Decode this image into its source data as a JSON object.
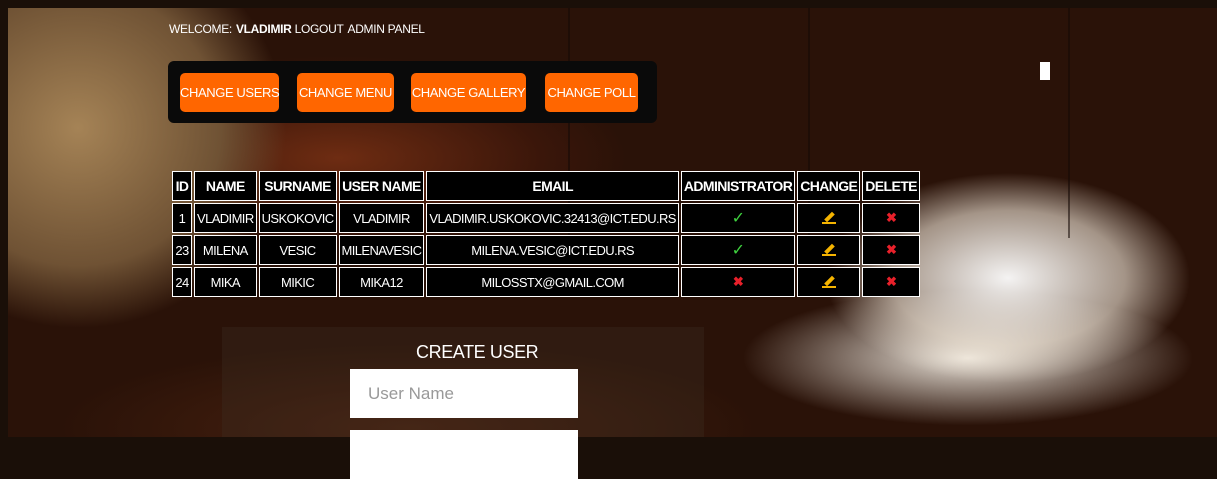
{
  "header": {
    "welcome_prefix": "WELCOME:",
    "username": "VLADIMIR",
    "logout": "LOGOUT",
    "admin_panel": "ADMIN PANEL"
  },
  "nav": {
    "buttons": [
      {
        "label": "CHANGE USERS"
      },
      {
        "label": "CHANGE MENU"
      },
      {
        "label": "CHANGE GALLERY"
      },
      {
        "label": "CHANGE POLL"
      }
    ],
    "button_color": "#ff6600"
  },
  "users_table": {
    "columns": [
      "ID",
      "NAME",
      "SURNAME",
      "USER NAME",
      "EMAIL",
      "ADMINISTRATOR",
      "CHANGE",
      "DELETE"
    ],
    "rows": [
      {
        "id": "1",
        "name": "VLADIMIR",
        "surname": "USKOKOVIC",
        "username": "VLADIMIR",
        "email": "VLADIMIR.USKOKOVIC.32413@ICT.EDU.RS",
        "admin_icon": "check-icon"
      },
      {
        "id": "23",
        "name": "MILENA",
        "surname": "VESIC",
        "username": "MILENAVESIC",
        "email": "MILENA.VESIC@ICT.EDU.RS",
        "admin_icon": "check-icon"
      },
      {
        "id": "24",
        "name": "MIKA",
        "surname": "MIKIC",
        "username": "MIKA12",
        "email": "MILOSSTX@GMAIL.COM",
        "admin_icon": "cross-icon"
      }
    ],
    "change_icon": "pencil-icon",
    "delete_icon": "cross-icon"
  },
  "create_user": {
    "title": "CREATE USER",
    "username_placeholder": "User Name",
    "second_field_placeholder": ""
  }
}
